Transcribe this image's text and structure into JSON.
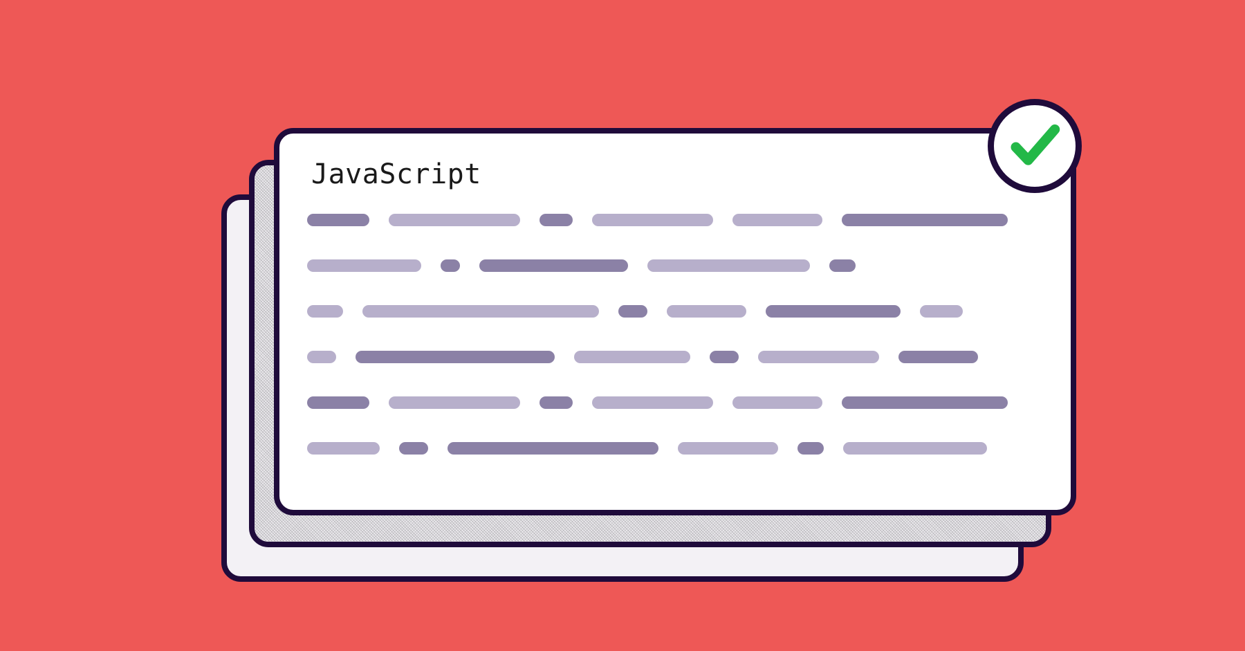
{
  "card": {
    "title": "JavaScript"
  },
  "colors": {
    "background": "#ee5856",
    "cardBorder": "#1f0b3b",
    "segmentDark": "#8b81a6",
    "segmentLight": "#b7afcb",
    "checkmark": "#23b847"
  },
  "icons": {
    "badge": "checkmark-icon"
  }
}
